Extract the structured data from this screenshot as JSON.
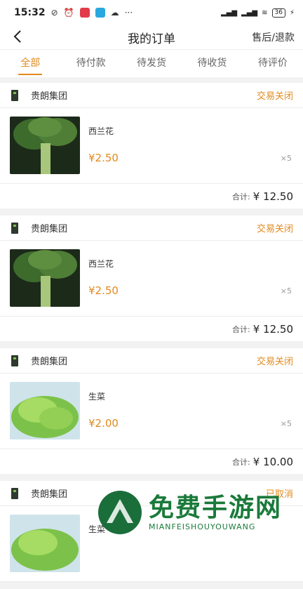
{
  "status_bar": {
    "time": "15:32",
    "battery": "36"
  },
  "nav": {
    "title": "我的订单",
    "after_sales": "售后/退款"
  },
  "tabs": [
    {
      "label": "全部"
    },
    {
      "label": "待付款"
    },
    {
      "label": "待发货"
    },
    {
      "label": "待收货"
    },
    {
      "label": "待评价"
    }
  ],
  "orders": [
    {
      "shop": "贵朗集团",
      "status": "交易关闭",
      "product": "西兰花",
      "price": "¥2.50",
      "qty": "×5",
      "total_label": "合计:",
      "total": "¥ 12.50"
    },
    {
      "shop": "贵朗集团",
      "status": "交易关闭",
      "product": "西兰花",
      "price": "¥2.50",
      "qty": "×5",
      "total_label": "合计:",
      "total": "¥ 12.50"
    },
    {
      "shop": "贵朗集团",
      "status": "交易关闭",
      "product": "生菜",
      "price": "¥2.00",
      "qty": "×5",
      "total_label": "合计:",
      "total": "¥ 10.00"
    },
    {
      "shop": "贵朗集团",
      "status": "已取消",
      "product": "生菜",
      "price": "",
      "qty": "",
      "total_label": "",
      "total": ""
    }
  ],
  "watermark": {
    "cn": "免费手游网",
    "en": "MIANFEISHOUYOUWANG"
  }
}
